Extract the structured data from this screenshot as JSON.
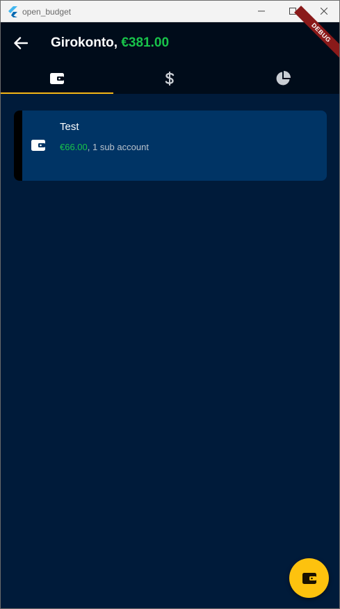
{
  "window": {
    "title": "open_budget",
    "icons": {
      "app": "flutter-logo-icon",
      "minimize": "minimize-icon",
      "maximize": "maximize-icon",
      "close": "close-icon"
    }
  },
  "appbar": {
    "back_icon": "arrow-left-icon",
    "title": "Girokonto,",
    "amount": "€381.00",
    "debug_banner": "DEBUG",
    "tabs": [
      {
        "icon": "wallet-icon",
        "selected": true
      },
      {
        "icon": "dollar-icon",
        "selected": false
      },
      {
        "icon": "pie-chart-icon",
        "selected": false
      }
    ]
  },
  "accounts": [
    {
      "name": "Test",
      "amount": "€66.00",
      "detail": ", 1 sub account",
      "icon": "wallet-icon"
    }
  ],
  "fab": {
    "icon": "wallet-icon"
  },
  "colors": {
    "background": "#001b3a",
    "appbar": "#000c1a",
    "card": "#003465",
    "accent": "#f6b715",
    "fab": "#fdc20e",
    "positive": "#18c34a"
  }
}
